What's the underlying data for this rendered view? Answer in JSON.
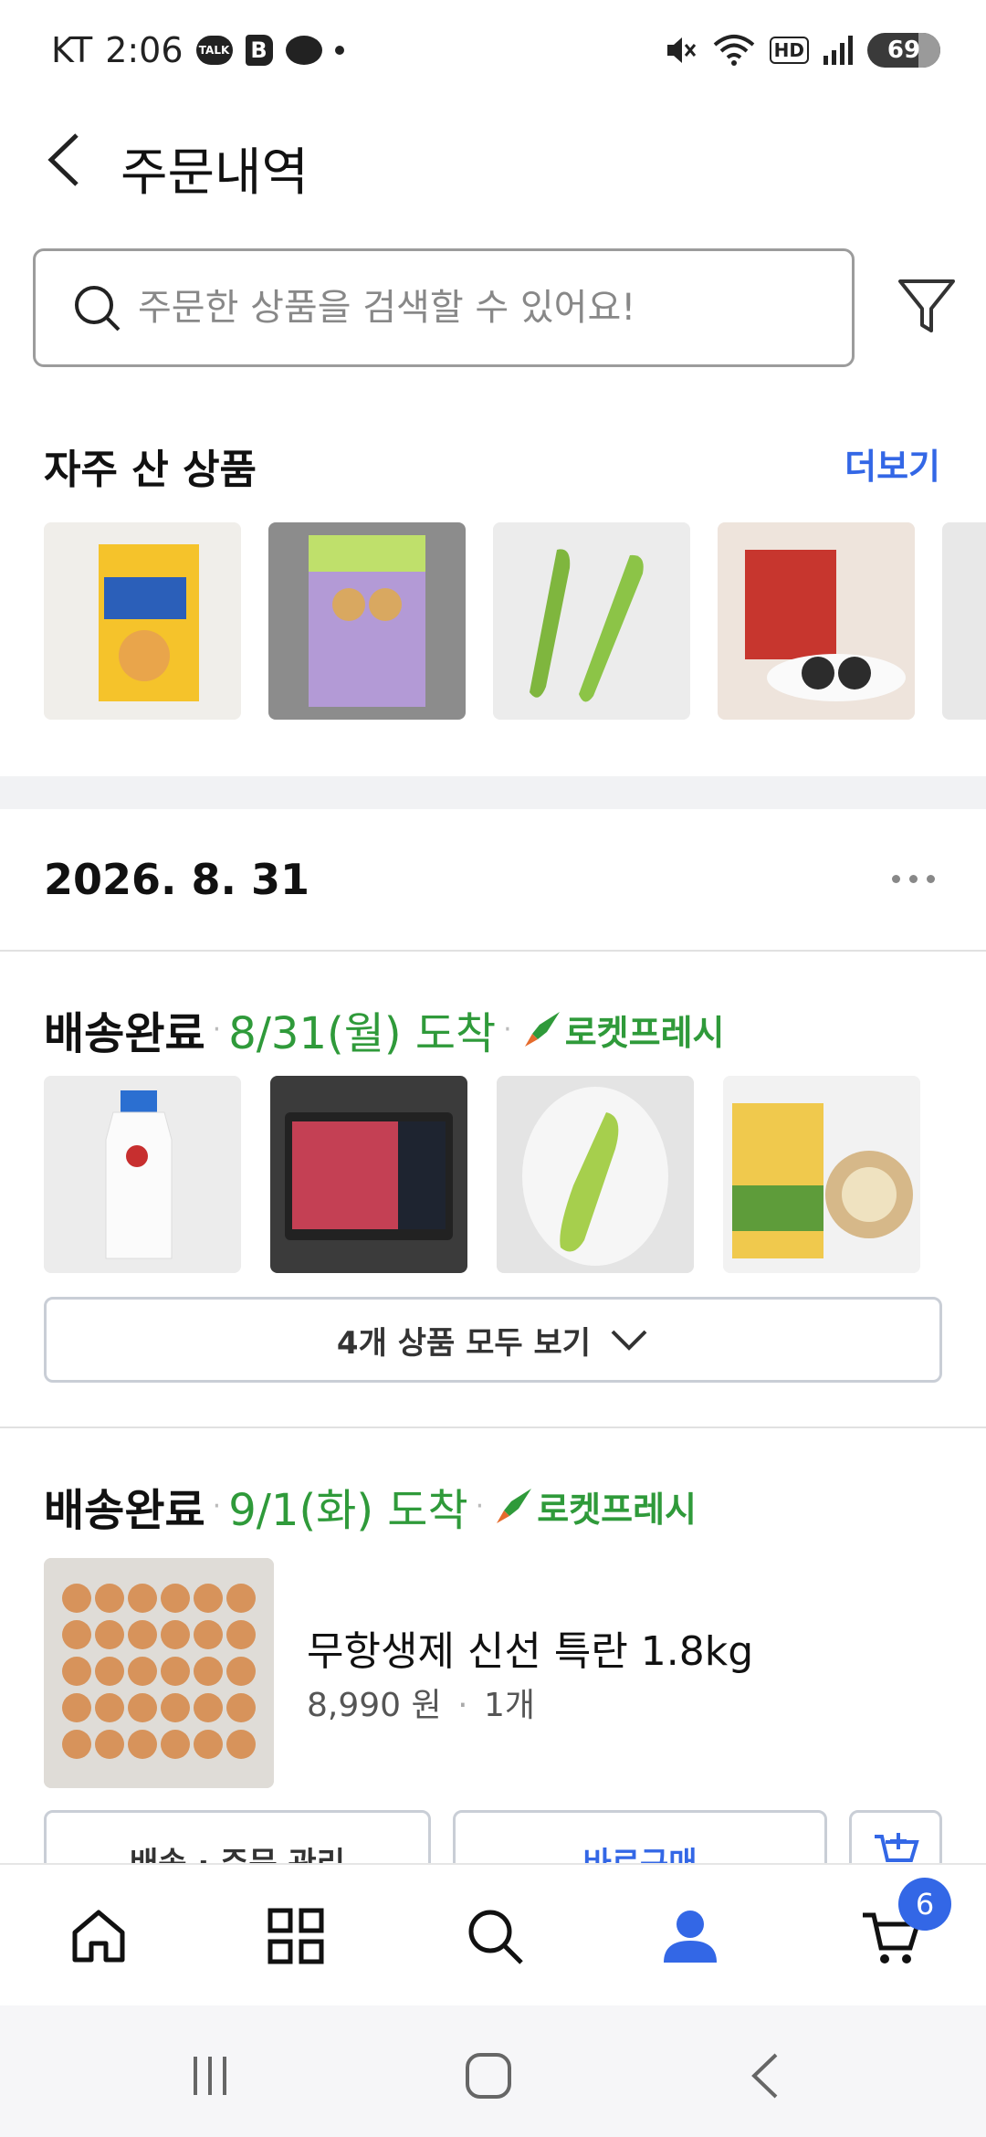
{
  "status_bar": {
    "carrier": "KT",
    "time": "2:06",
    "battery": "69",
    "talk_label": "TALK",
    "b_label": "B",
    "hd_label": "HD"
  },
  "header": {
    "title": "주문내역"
  },
  "search": {
    "placeholder": "주문한 상품을 검색할 수 있어요!"
  },
  "frequent": {
    "title": "자주 산 상품",
    "more_label": "더보기"
  },
  "order": {
    "date": "2026. 8. 31",
    "groups": [
      {
        "status": "배송완료",
        "arrival": "8/31(월) 도착",
        "badge": "로켓프레시",
        "view_all_label": "4개 상품 모두 보기"
      },
      {
        "status": "배송완료",
        "arrival": "9/1(화) 도착",
        "badge": "로켓프레시",
        "item": {
          "name": "무항생제 신선 특란 1.8kg",
          "price": "8,990 원",
          "qty": "1개"
        },
        "buttons": {
          "manage": "배송 · 주문 관리",
          "buy": "바로구매"
        }
      }
    ]
  },
  "bottom_nav": {
    "cart_badge": "6"
  },
  "colors": {
    "accent_blue": "#3367e6",
    "fresh_green": "#2f9a3a"
  }
}
